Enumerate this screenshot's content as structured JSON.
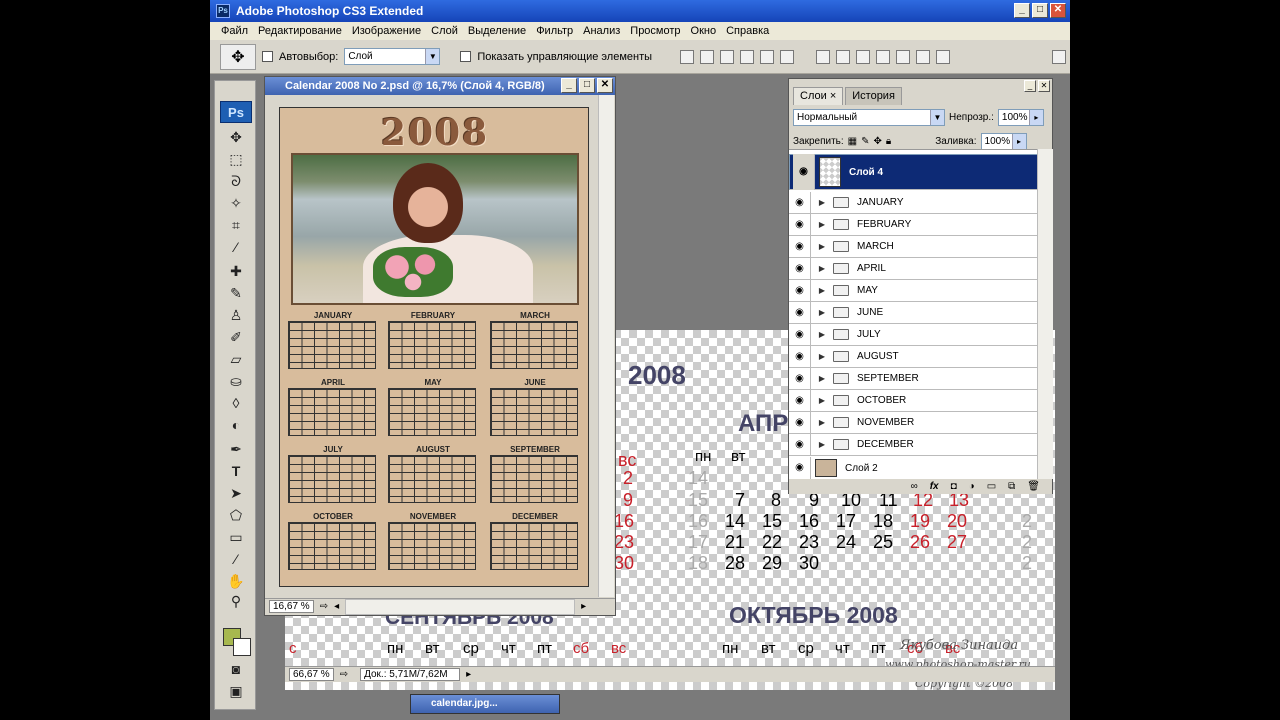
{
  "app": {
    "title": "Adobe Photoshop CS3 Extended"
  },
  "menu": [
    "Файл",
    "Редактирование",
    "Изображение",
    "Слой",
    "Выделение",
    "Фильтр",
    "Анализ",
    "Просмотр",
    "Окно",
    "Справка"
  ],
  "options": {
    "autoselect_label": "Автовыбор:",
    "autoselect_value": "Слой",
    "show_controls_label": "Показать управляющие элементы"
  },
  "document": {
    "title": "Calendar 2008 No 2.psd @ 16,7% (Слой 4, RGB/8)",
    "zoom": "16,67 %",
    "year": "2008",
    "months": [
      "JANUARY",
      "FEBRUARY",
      "MARCH",
      "APRIL",
      "MAY",
      "JUNE",
      "JULY",
      "AUGUST",
      "SEPTEMBER",
      "OCTOBER",
      "NOVEMBER",
      "DECEMBER"
    ]
  },
  "background_doc": {
    "year": "2008",
    "april_label": "АПР",
    "sept_label": "СЕНТЯБРЬ 2008",
    "oct_label": "ОКТЯБРЬ 2008",
    "dow_row1": [
      "пн",
      "вт"
    ],
    "dow_row2": [
      "пн",
      "вт",
      "ср",
      "чт",
      "пт",
      "сб",
      "вс"
    ],
    "dow_row2_left": [
      "с",
      "пн",
      "вт",
      "ср",
      "чт",
      "пт",
      "сб",
      "вс"
    ],
    "left_col": [
      "вс",
      "2",
      "9",
      "16",
      "23",
      "30"
    ],
    "days": {
      "r1": [
        "14",
        "15",
        "16",
        "17",
        "18"
      ],
      "r2": [
        "7",
        "8",
        "9",
        "10",
        "11",
        "12",
        "13"
      ],
      "r3": [
        "14",
        "15",
        "16",
        "17",
        "18",
        "19",
        "20"
      ],
      "r4": [
        "21",
        "22",
        "23",
        "24",
        "25",
        "26",
        "27"
      ],
      "r5": [
        "28",
        "29",
        "30"
      ]
    },
    "right_col": [
      "2",
      "2",
      "2",
      "2"
    ],
    "zoom": "66,67 %",
    "doc_size": "Док.: 5,71M/7,62M",
    "watermark": [
      "Якубова Зинаида",
      "www.photoshop-master.ru",
      "Copyright ©2008"
    ]
  },
  "layers": {
    "tabs": [
      "Слои",
      "История"
    ],
    "blend_mode": "Нормальный",
    "opacity_label": "Непрозр.:",
    "opacity": "100%",
    "lock_label": "Закрепить:",
    "fill_label": "Заливка:",
    "fill": "100%",
    "selected": "Слой 4",
    "folders": [
      "JANUARY",
      "FEBRUARY",
      "MARCH",
      "APRIL",
      "MAY",
      "JUNE",
      "JULY",
      "AUGUST",
      "SEPTEMBER",
      "OCTOBER",
      "NOVEMBER",
      "DECEMBER"
    ],
    "bottom": "Слой 2"
  },
  "mini_window": {
    "title": "calendar.jpg..."
  }
}
